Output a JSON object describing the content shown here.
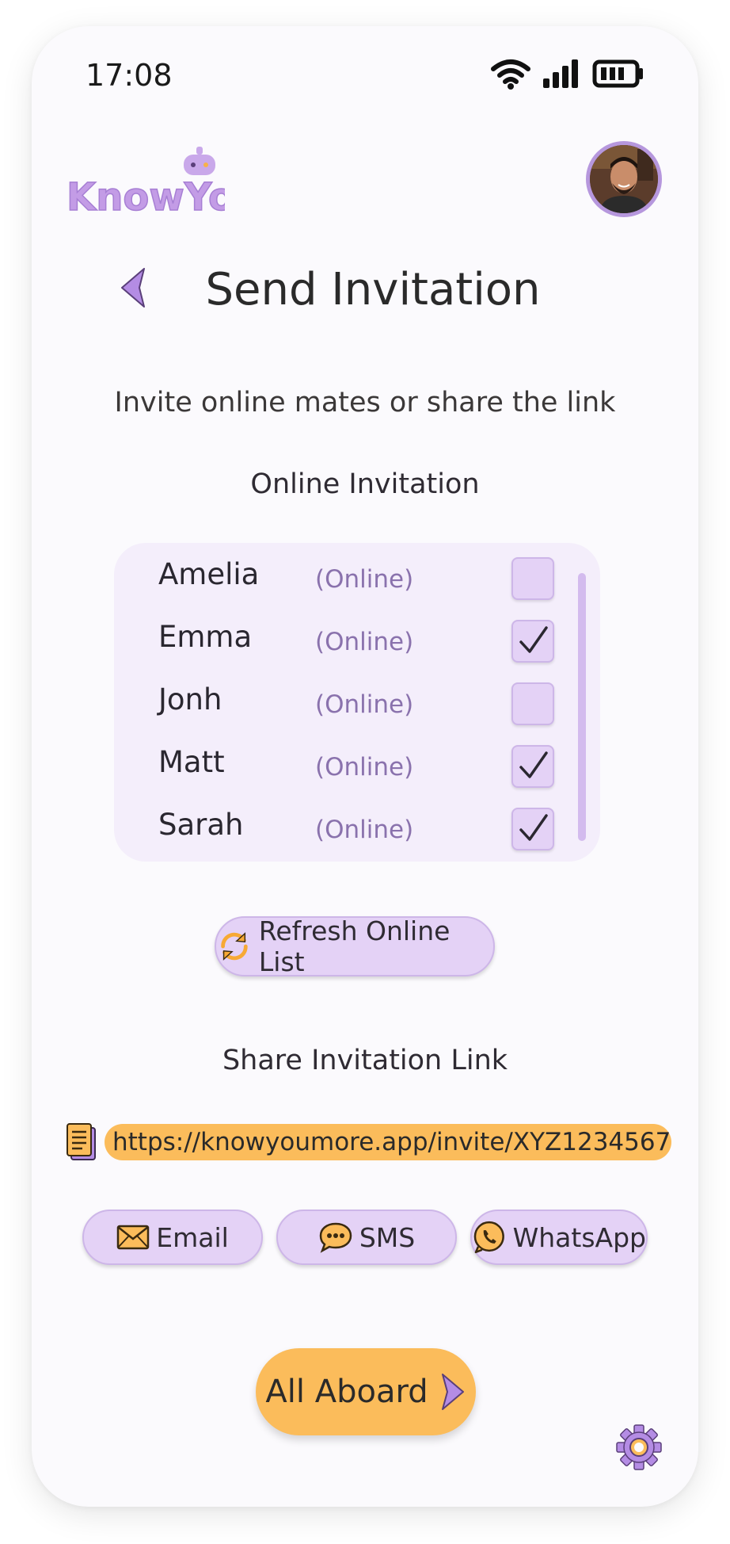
{
  "status_bar": {
    "time": "17:08"
  },
  "app": {
    "logo_text": "KnowYou"
  },
  "header": {
    "title": "Send Invitation"
  },
  "subtitle": "Invite online mates or share the link",
  "online_section": {
    "title": "Online Invitation",
    "friends": [
      {
        "name": "Amelia",
        "status": "(Online)",
        "checked": false
      },
      {
        "name": "Emma",
        "status": "(Online)",
        "checked": true
      },
      {
        "name": "Jonh",
        "status": "(Online)",
        "checked": false
      },
      {
        "name": "Matt",
        "status": "(Online)",
        "checked": true
      },
      {
        "name": "Sarah",
        "status": "(Online)",
        "checked": true
      }
    ],
    "refresh_label": "Refresh Online List"
  },
  "share_section": {
    "title": "Share Invitation Link",
    "link": "https://knowyoumore.app/invite/XYZ1234567",
    "buttons": {
      "email": "Email",
      "sms": "SMS",
      "whatsapp": "WhatsApp"
    }
  },
  "cta": {
    "label": "All Aboard"
  },
  "colors": {
    "accent_purple": "#b697dd",
    "light_purple": "#e4d2f6",
    "accent_orange": "#fbbc5b",
    "background": "#fbfafd"
  }
}
